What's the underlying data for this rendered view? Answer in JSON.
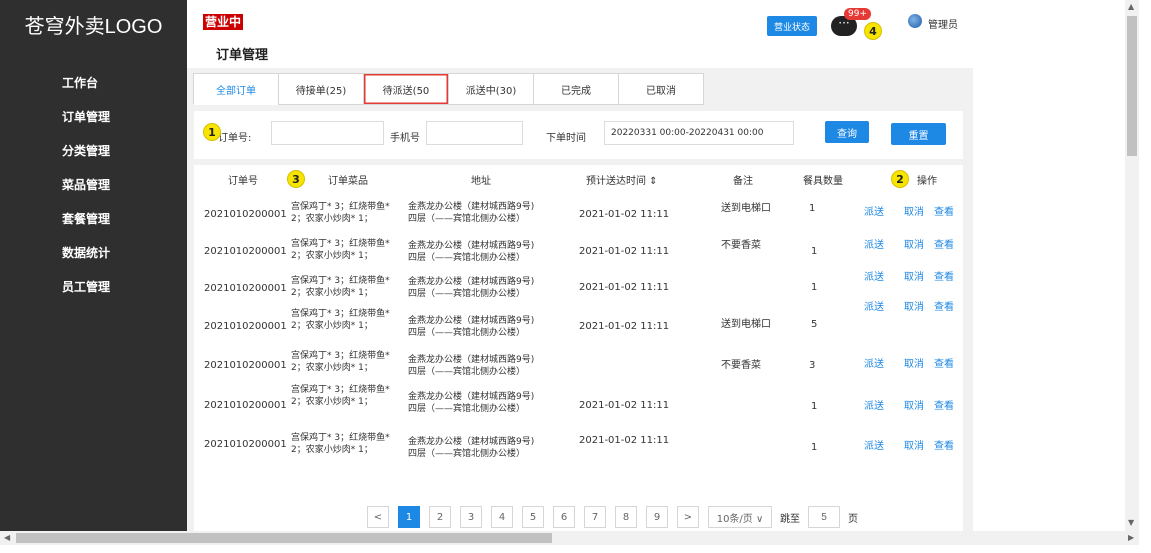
{
  "sidebar": {
    "logo": "苍穹外卖LOGO",
    "items": [
      "工作台",
      "订单管理",
      "分类管理",
      "菜品管理",
      "套餐管理",
      "数据统计",
      "员工管理"
    ]
  },
  "header": {
    "status_tag": "营业中",
    "title": "订单管理",
    "biz_status_btn": "营业状态",
    "msg_icon": "···",
    "msg_badge": "99+",
    "user": "管理员"
  },
  "tabs": [
    "全部订单",
    "待接单(25)",
    "待派送(50",
    "派送中(30)",
    "已完成",
    "已取消"
  ],
  "filter": {
    "order_label": "订单号:",
    "phone_label": "手机号",
    "time_label": "下单时间",
    "time_value": "20220331 00:00-20220431 00:00",
    "search_btn": "查询",
    "reset_btn": "重置"
  },
  "table": {
    "headers": [
      "订单号",
      "订单菜品",
      "地址",
      "预计送达时间 ⇕",
      "备注",
      "餐具数量",
      "操作"
    ],
    "rows": [
      {
        "id": "2021010200001",
        "dish1": "宫保鸡丁* 3；红烧带鱼*",
        "dish2": "2；农家小炒肉* 1；",
        "addr1": "金燕龙办公楼（建材城西路9号)",
        "addr2": "四层（——宾馆北侧办公楼）",
        "time": "2021-01-02 11:11",
        "note": "送到电梯口",
        "qty": "1",
        "op1": "派送",
        "op2": "取消",
        "op3": "查看"
      },
      {
        "id": "2021010200001",
        "dish1": "宫保鸡丁* 3；红烧带鱼*",
        "dish2": "2；农家小炒肉* 1；",
        "addr1": "金燕龙办公楼（建材城西路9号)",
        "addr2": "四层（——宾馆北侧办公楼）",
        "time": "2021-01-02 11:11",
        "note": "不要香菜",
        "qty": "1",
        "op1": "派送",
        "op2": "取消",
        "op3": "查看"
      },
      {
        "id": "2021010200001",
        "dish1": "宫保鸡丁* 3；红烧带鱼*",
        "dish2": "2；农家小炒肉* 1；",
        "addr1": "金燕龙办公楼（建材城西路9号)",
        "addr2": "四层（——宾馆北侧办公楼）",
        "time": "2021-01-02 11:11",
        "note": "",
        "qty": "1",
        "op1": "派送",
        "op2": "取消",
        "op3": "查看"
      },
      {
        "id": "2021010200001",
        "dish1": "宫保鸡丁* 3；红烧带鱼*",
        "dish2": "2；农家小炒肉* 1；",
        "addr1": "金燕龙办公楼（建材城西路9号)",
        "addr2": "四层（——宾馆北侧办公楼）",
        "time": "2021-01-02 11:11",
        "note": "送到电梯口",
        "qty": "5",
        "op1": "派送",
        "op2": "取消",
        "op3": "查看"
      },
      {
        "id": "2021010200001",
        "dish1": "宫保鸡丁* 3；红烧带鱼*",
        "dish2": "2；农家小炒肉* 1；",
        "addr1": "金燕龙办公楼（建材城西路9号)",
        "addr2": "四层（——宾馆北侧办公楼）",
        "time": "2021-01-02 11:11",
        "note": "不要香菜",
        "qty": "3",
        "op1": "派送",
        "op2": "取消",
        "op3": "查看"
      },
      {
        "id": "2021010200001",
        "dish1": "宫保鸡丁* 3；红烧带鱼*",
        "dish2": "2；农家小炒肉* 1；",
        "addr1": "金燕龙办公楼（建材城西路9号)",
        "addr2": "四层（——宾馆北侧办公楼）",
        "time": "2021-01-02 11:11",
        "note": "",
        "qty": "1",
        "op1": "派送",
        "op2": "取消",
        "op3": "查看"
      },
      {
        "id": "2021010200001",
        "dish1": "宫保鸡丁* 3；红烧带鱼*",
        "dish2": "2；农家小炒肉* 1；",
        "addr1": "金燕龙办公楼（建材城西路9号)",
        "addr2": "四层（——宾馆北侧办公楼）",
        "time": "2021-01-02 11:11",
        "note": "",
        "qty": "1",
        "op1": "派送",
        "op2": "取消",
        "op3": "查看"
      }
    ]
  },
  "markers": [
    "1",
    "2",
    "3",
    "4"
  ],
  "pagination": {
    "prev": "<",
    "pages": [
      "1",
      "2",
      "3",
      "4",
      "5",
      "6",
      "7",
      "8",
      "9"
    ],
    "next": ">",
    "size": "10条/页 ∨",
    "goto_label": "跳至",
    "goto_value": "5",
    "page_label": "页"
  },
  "colors": {
    "accent": "#1e88e5",
    "sidebar": "#2f2f2f",
    "highlight": "#e53935"
  }
}
